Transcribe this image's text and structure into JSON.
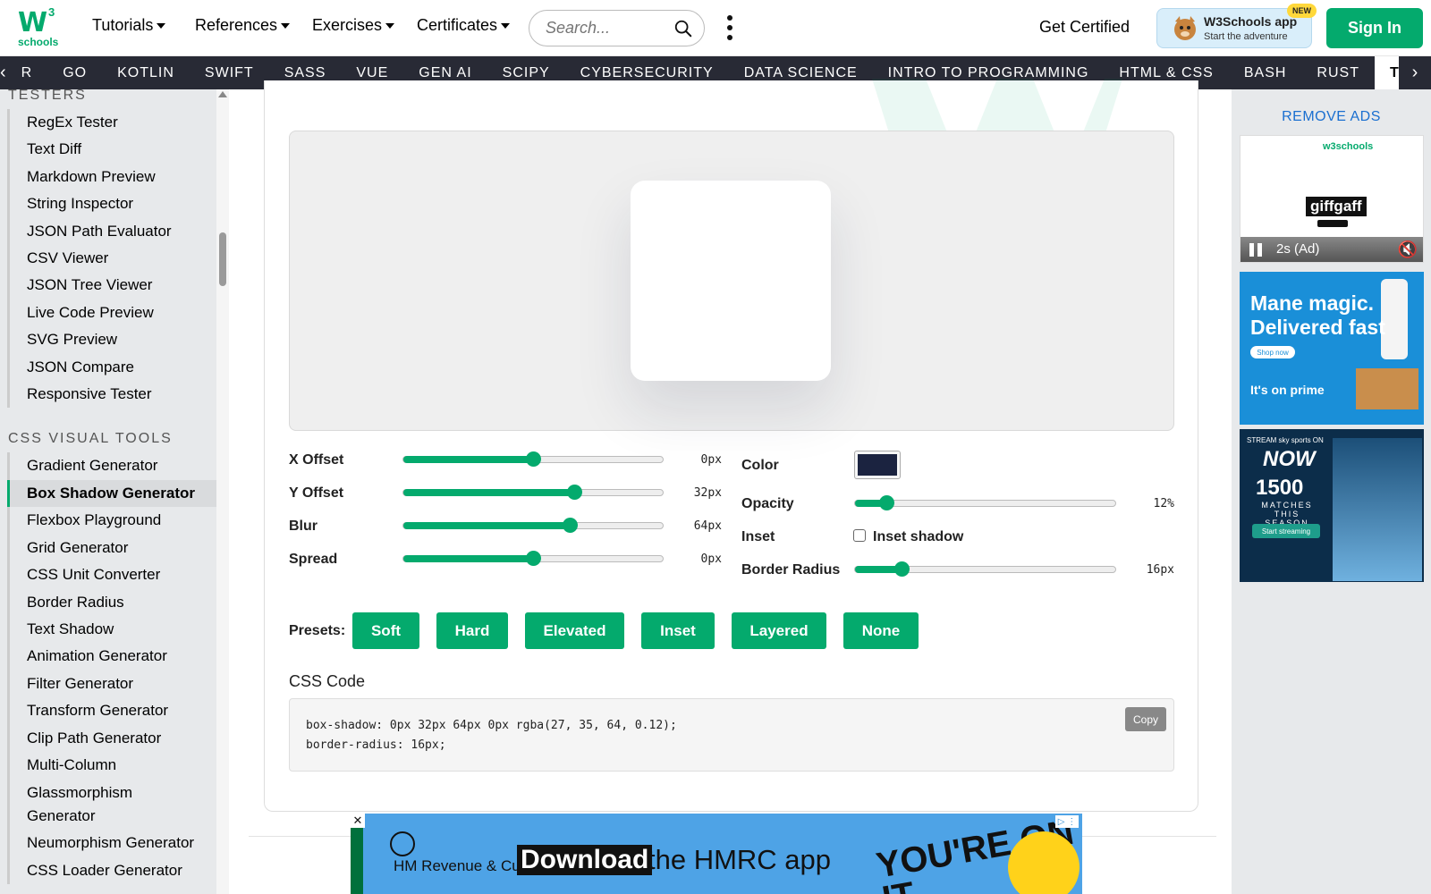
{
  "header": {
    "logo_text": "schools",
    "logo_mark": "W",
    "logo_sup": "3",
    "menus": [
      {
        "label": "Tutorials"
      },
      {
        "label": "References"
      },
      {
        "label": "Exercises"
      },
      {
        "label": "Certificates"
      }
    ],
    "search_placeholder": "Search...",
    "get_certified": "Get Certified",
    "app_title": "W3Schools app",
    "app_subtitle": "Start the adventure",
    "app_badge": "NEW",
    "sign_in": "Sign In"
  },
  "subjects": {
    "items": [
      "R",
      "GO",
      "KOTLIN",
      "SWIFT",
      "SASS",
      "VUE",
      "GEN AI",
      "SCIPY",
      "CYBERSECURITY",
      "DATA SCIENCE",
      "INTRO TO PROGRAMMING",
      "HTML & CSS",
      "BASH",
      "RUST",
      "TOOLS"
    ],
    "active": "TOOLS",
    "left_arrow": "‹",
    "right_arrow": "›"
  },
  "sidebar": {
    "testers_title": "TESTERS",
    "testers": [
      "RegEx Tester",
      "Text Diff",
      "Markdown Preview",
      "String Inspector",
      "JSON Path Evaluator",
      "CSV Viewer",
      "JSON Tree Viewer",
      "Live Code Preview",
      "SVG Preview",
      "JSON Compare",
      "Responsive Tester"
    ],
    "css_title": "CSS VISUAL TOOLS",
    "css_tools": [
      "Gradient Generator",
      "Box Shadow Generator",
      "Flexbox Playground",
      "Grid Generator",
      "CSS Unit Converter",
      "Border Radius",
      "Text Shadow",
      "Animation Generator",
      "Filter Generator",
      "Transform Generator",
      "Clip Path Generator",
      "Multi-Column",
      "Glassmorphism Generator",
      "Neumorphism Generator",
      "CSS Loader Generator"
    ],
    "active_tool": "Box Shadow Generator"
  },
  "controls": {
    "x_offset": {
      "label": "X Offset",
      "value": "0px",
      "level": 0.5
    },
    "y_offset": {
      "label": "Y Offset",
      "value": "32px",
      "level": 0.66
    },
    "blur": {
      "label": "Blur",
      "value": "64px",
      "level": 0.64
    },
    "spread": {
      "label": "Spread",
      "value": "0px",
      "level": 0.5
    },
    "color": {
      "label": "Color",
      "hex": "#1b2340"
    },
    "opacity": {
      "label": "Opacity",
      "value": "12%",
      "level": 0.12
    },
    "inset": {
      "label": "Inset",
      "checkbox_label": "Inset shadow",
      "checked": false
    },
    "border_radius": {
      "label": "Border Radius",
      "value": "16px",
      "level": 0.18
    }
  },
  "presets": {
    "label": "Presets:",
    "buttons": [
      "Soft",
      "Hard",
      "Elevated",
      "Inset",
      "Layered",
      "None"
    ]
  },
  "code": {
    "title": "CSS Code",
    "line1": "box-shadow: 0px 32px 64px 0px rgba(27, 35, 64, 0.12);",
    "line2": "border-radius: 16px;",
    "copy": "Copy"
  },
  "right_ads": {
    "remove_ads": "REMOVE ADS",
    "ad1_brand": "giffgaff",
    "ad1_logo": "w3schools",
    "ad1_time": "2s (Ad)",
    "ad2_headline": "Mane magic. Delivered fast",
    "ad2_shop": "Shop now",
    "ad2_prime": "It's on prime",
    "ad3_stream": "STREAM sky sports ON",
    "ad3_now": "NOW",
    "ad3_number": "1500",
    "ad3_matches": "MATCHES THIS SEASON",
    "ad3_cta": "Start streaming"
  },
  "bottom_ad": {
    "org": "HM Revenue & Customs",
    "download": "Download",
    "rest": "the HMRC app",
    "slogan": "YOU'RE ON IT"
  },
  "colors": {
    "brand_green": "#04aa6d",
    "subject_bar": "#282a35",
    "sidebar_bg": "#e7e9eb"
  }
}
